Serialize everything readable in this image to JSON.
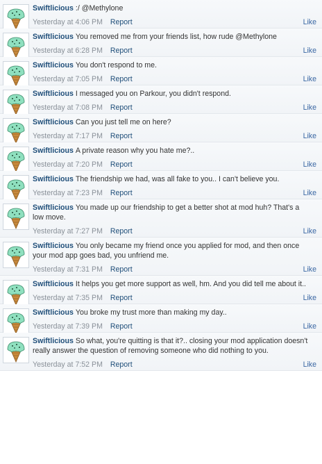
{
  "colors": {
    "username": "#1f4e79",
    "link": "#3a67a3",
    "timestamp": "#8a9199"
  },
  "avatar_icon": "ice-cream-cone-icon",
  "posts": [
    {
      "user": "Swiftlicious",
      "text": ":/ @Methylone",
      "time": "Yesterday at 4:06 PM",
      "report": "Report",
      "like": "Like"
    },
    {
      "user": "Swiftlicious",
      "text": "You removed me from your friends list, how rude @Methylone",
      "time": "Yesterday at 6:28 PM",
      "report": "Report",
      "like": "Like"
    },
    {
      "user": "Swiftlicious",
      "text": "You don't respond to me.",
      "time": "Yesterday at 7:05 PM",
      "report": "Report",
      "like": "Like"
    },
    {
      "user": "Swiftlicious",
      "text": "I messaged you on Parkour, you didn't respond.",
      "time": "Yesterday at 7:08 PM",
      "report": "Report",
      "like": "Like"
    },
    {
      "user": "Swiftlicious",
      "text": "Can you just tell me on here?",
      "time": "Yesterday at 7:17 PM",
      "report": "Report",
      "like": "Like"
    },
    {
      "user": "Swiftlicious",
      "text": "A private reason why you hate me?..",
      "time": "Yesterday at 7:20 PM",
      "report": "Report",
      "like": "Like"
    },
    {
      "user": "Swiftlicious",
      "text": "The friendship we had, was all fake to you.. I can't believe you.",
      "time": "Yesterday at 7:23 PM",
      "report": "Report",
      "like": "Like"
    },
    {
      "user": "Swiftlicious",
      "text": "You made up our friendship to get a better shot at mod huh? That's a low move.",
      "time": "Yesterday at 7:27 PM",
      "report": "Report",
      "like": "Like"
    },
    {
      "user": "Swiftlicious",
      "text": "You only became my friend once you applied for mod, and then once your mod app goes bad, you unfriend me.",
      "time": "Yesterday at 7:31 PM",
      "report": "Report",
      "like": "Like"
    },
    {
      "user": "Swiftlicious",
      "text": "It helps you get more support as well, hm. And you did tell me about it..",
      "time": "Yesterday at 7:35 PM",
      "report": "Report",
      "like": "Like"
    },
    {
      "user": "Swiftlicious",
      "text": "You broke my trust more than making my day..",
      "time": "Yesterday at 7:39 PM",
      "report": "Report",
      "like": "Like"
    },
    {
      "user": "Swiftlicious",
      "text": "So what, you're quitting is that it?.. closing your mod application doesn't really answer the question of removing someone who did nothing to you.",
      "time": "Yesterday at 7:52 PM",
      "report": "Report",
      "like": "Like"
    }
  ]
}
